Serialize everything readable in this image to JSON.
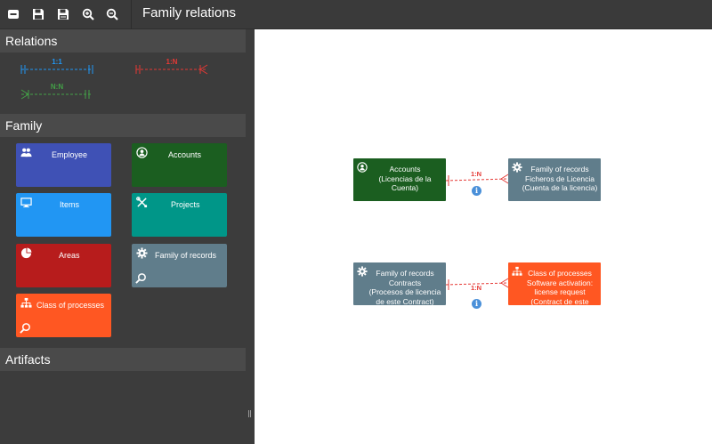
{
  "app": {
    "title": "Family relations",
    "toolbar": [
      {
        "name": "minimize-button",
        "icon": "minus-square-icon"
      },
      {
        "name": "save-button",
        "icon": "save-icon"
      },
      {
        "name": "save-as-button",
        "icon": "save-as-icon"
      },
      {
        "name": "zoom-in-button",
        "icon": "zoom-in-icon"
      },
      {
        "name": "zoom-out-button",
        "icon": "zoom-out-icon"
      }
    ]
  },
  "sidebar": {
    "relations": {
      "title": "Relations",
      "items": [
        {
          "label": "1:1",
          "color": "#2196f3"
        },
        {
          "label": "1:N",
          "color": "#e53935"
        },
        {
          "label": "N:N",
          "color": "#43a047"
        }
      ]
    },
    "family": {
      "title": "Family",
      "items": [
        {
          "label": "Employee",
          "color": "#3f51b5",
          "icon": "people-icon"
        },
        {
          "label": "Accounts",
          "color": "#1b5e20",
          "icon": "user-circle-icon"
        },
        {
          "label": "Items",
          "color": "#2196f3",
          "icon": "monitor-icon"
        },
        {
          "label": "Projects",
          "color": "#009688",
          "icon": "tools-icon"
        },
        {
          "label": "Areas",
          "color": "#b71c1c",
          "icon": "pie-chart-icon"
        },
        {
          "label": "Family of records",
          "color": "#607d8b",
          "icon": "gear-icon"
        },
        {
          "label": "Class of processes",
          "color": "#ff5722",
          "icon": "hierarchy-icon"
        }
      ]
    },
    "artifacts": {
      "title": "Artifacts"
    }
  },
  "canvas": {
    "nodes": [
      {
        "lines": [
          "Accounts",
          "(Licencias de la",
          "Cuenta)"
        ],
        "color": "#1b5e20",
        "icon": "user-circle-icon"
      },
      {
        "lines": [
          "Family of records",
          "Ficheros de Licencia",
          "(Cuenta de la licencia)"
        ],
        "color": "#607d8b",
        "icon": "gear-icon"
      },
      {
        "lines": [
          "Family of records",
          "Contracts",
          "(Procesos de licencia",
          "de este Contract)"
        ],
        "color": "#607d8b",
        "icon": "gear-icon"
      },
      {
        "lines": [
          "Class of processes",
          "Software activation:",
          "license request",
          "(Contract de este"
        ],
        "color": "#ff5722",
        "icon": "hierarchy-icon"
      }
    ],
    "connections": [
      {
        "label": "1:N",
        "color": "#e53935"
      },
      {
        "label": "1:N",
        "color": "#e53935"
      }
    ],
    "info_glyph": "i"
  }
}
